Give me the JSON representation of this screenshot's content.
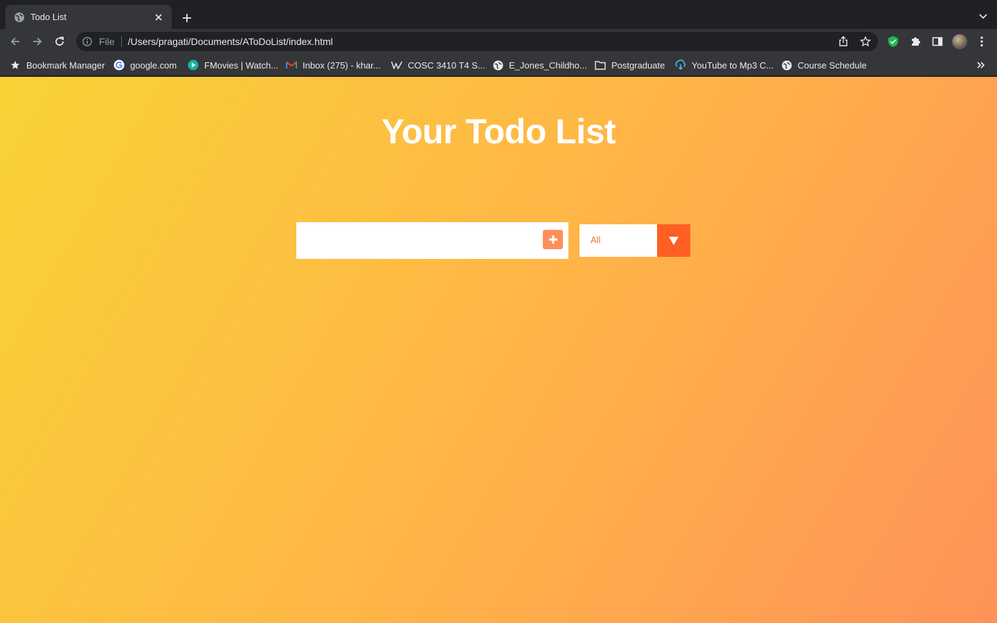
{
  "browser": {
    "tab": {
      "title": "Todo List"
    },
    "omnibox": {
      "scheme": "File",
      "url": "/Users/pragati/Documents/AToDoList/index.html"
    },
    "bookmarks": [
      {
        "label": "Bookmark Manager",
        "icon": "star-icon"
      },
      {
        "label": "google.com",
        "icon": "google-icon"
      },
      {
        "label": "FMovies | Watch...",
        "icon": "play-icon"
      },
      {
        "label": "Inbox (275) - khar...",
        "icon": "gmail-icon"
      },
      {
        "label": "COSC 3410 T4 S...",
        "icon": "wikipedia-icon"
      },
      {
        "label": "E_Jones_Childho...",
        "icon": "globe-icon"
      },
      {
        "label": "Postgraduate",
        "icon": "folder-icon"
      },
      {
        "label": "YouTube to Mp3 C...",
        "icon": "download-icon"
      },
      {
        "label": "Course Schedule",
        "icon": "globe-icon"
      }
    ]
  },
  "app": {
    "title": "Your Todo List",
    "input": {
      "value": "",
      "placeholder": ""
    },
    "filter": {
      "selected": "All"
    },
    "colors": {
      "gradient_start": "#f8d236",
      "gradient_end": "#ff9258",
      "add_button": "#ff8f5a",
      "filter_accent": "#ff5f22",
      "filter_text": "#ff6a2b"
    }
  }
}
